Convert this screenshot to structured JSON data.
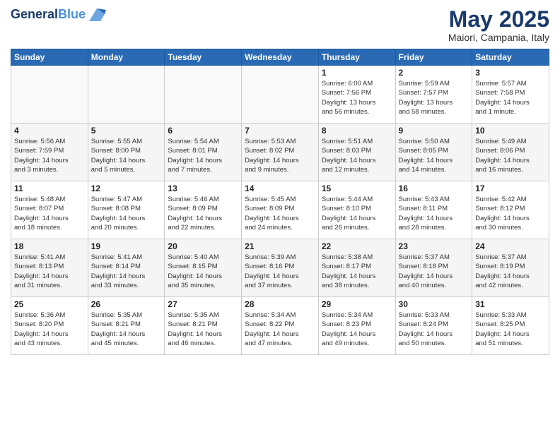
{
  "header": {
    "logo_line1": "General",
    "logo_line2": "Blue",
    "month": "May 2025",
    "location": "Maiori, Campania, Italy"
  },
  "weekdays": [
    "Sunday",
    "Monday",
    "Tuesday",
    "Wednesday",
    "Thursday",
    "Friday",
    "Saturday"
  ],
  "weeks": [
    [
      {
        "day": "",
        "info": ""
      },
      {
        "day": "",
        "info": ""
      },
      {
        "day": "",
        "info": ""
      },
      {
        "day": "",
        "info": ""
      },
      {
        "day": "1",
        "info": "Sunrise: 6:00 AM\nSunset: 7:56 PM\nDaylight: 13 hours\nand 56 minutes."
      },
      {
        "day": "2",
        "info": "Sunrise: 5:59 AM\nSunset: 7:57 PM\nDaylight: 13 hours\nand 58 minutes."
      },
      {
        "day": "3",
        "info": "Sunrise: 5:57 AM\nSunset: 7:58 PM\nDaylight: 14 hours\nand 1 minute."
      }
    ],
    [
      {
        "day": "4",
        "info": "Sunrise: 5:56 AM\nSunset: 7:59 PM\nDaylight: 14 hours\nand 3 minutes."
      },
      {
        "day": "5",
        "info": "Sunrise: 5:55 AM\nSunset: 8:00 PM\nDaylight: 14 hours\nand 5 minutes."
      },
      {
        "day": "6",
        "info": "Sunrise: 5:54 AM\nSunset: 8:01 PM\nDaylight: 14 hours\nand 7 minutes."
      },
      {
        "day": "7",
        "info": "Sunrise: 5:53 AM\nSunset: 8:02 PM\nDaylight: 14 hours\nand 9 minutes."
      },
      {
        "day": "8",
        "info": "Sunrise: 5:51 AM\nSunset: 8:03 PM\nDaylight: 14 hours\nand 12 minutes."
      },
      {
        "day": "9",
        "info": "Sunrise: 5:50 AM\nSunset: 8:05 PM\nDaylight: 14 hours\nand 14 minutes."
      },
      {
        "day": "10",
        "info": "Sunrise: 5:49 AM\nSunset: 8:06 PM\nDaylight: 14 hours\nand 16 minutes."
      }
    ],
    [
      {
        "day": "11",
        "info": "Sunrise: 5:48 AM\nSunset: 8:07 PM\nDaylight: 14 hours\nand 18 minutes."
      },
      {
        "day": "12",
        "info": "Sunrise: 5:47 AM\nSunset: 8:08 PM\nDaylight: 14 hours\nand 20 minutes."
      },
      {
        "day": "13",
        "info": "Sunrise: 5:46 AM\nSunset: 8:09 PM\nDaylight: 14 hours\nand 22 minutes."
      },
      {
        "day": "14",
        "info": "Sunrise: 5:45 AM\nSunset: 8:09 PM\nDaylight: 14 hours\nand 24 minutes."
      },
      {
        "day": "15",
        "info": "Sunrise: 5:44 AM\nSunset: 8:10 PM\nDaylight: 14 hours\nand 26 minutes."
      },
      {
        "day": "16",
        "info": "Sunrise: 5:43 AM\nSunset: 8:11 PM\nDaylight: 14 hours\nand 28 minutes."
      },
      {
        "day": "17",
        "info": "Sunrise: 5:42 AM\nSunset: 8:12 PM\nDaylight: 14 hours\nand 30 minutes."
      }
    ],
    [
      {
        "day": "18",
        "info": "Sunrise: 5:41 AM\nSunset: 8:13 PM\nDaylight: 14 hours\nand 31 minutes."
      },
      {
        "day": "19",
        "info": "Sunrise: 5:41 AM\nSunset: 8:14 PM\nDaylight: 14 hours\nand 33 minutes."
      },
      {
        "day": "20",
        "info": "Sunrise: 5:40 AM\nSunset: 8:15 PM\nDaylight: 14 hours\nand 35 minutes."
      },
      {
        "day": "21",
        "info": "Sunrise: 5:39 AM\nSunset: 8:16 PM\nDaylight: 14 hours\nand 37 minutes."
      },
      {
        "day": "22",
        "info": "Sunrise: 5:38 AM\nSunset: 8:17 PM\nDaylight: 14 hours\nand 38 minutes."
      },
      {
        "day": "23",
        "info": "Sunrise: 5:37 AM\nSunset: 8:18 PM\nDaylight: 14 hours\nand 40 minutes."
      },
      {
        "day": "24",
        "info": "Sunrise: 5:37 AM\nSunset: 8:19 PM\nDaylight: 14 hours\nand 42 minutes."
      }
    ],
    [
      {
        "day": "25",
        "info": "Sunrise: 5:36 AM\nSunset: 8:20 PM\nDaylight: 14 hours\nand 43 minutes."
      },
      {
        "day": "26",
        "info": "Sunrise: 5:35 AM\nSunset: 8:21 PM\nDaylight: 14 hours\nand 45 minutes."
      },
      {
        "day": "27",
        "info": "Sunrise: 5:35 AM\nSunset: 8:21 PM\nDaylight: 14 hours\nand 46 minutes."
      },
      {
        "day": "28",
        "info": "Sunrise: 5:34 AM\nSunset: 8:22 PM\nDaylight: 14 hours\nand 47 minutes."
      },
      {
        "day": "29",
        "info": "Sunrise: 5:34 AM\nSunset: 8:23 PM\nDaylight: 14 hours\nand 49 minutes."
      },
      {
        "day": "30",
        "info": "Sunrise: 5:33 AM\nSunset: 8:24 PM\nDaylight: 14 hours\nand 50 minutes."
      },
      {
        "day": "31",
        "info": "Sunrise: 5:33 AM\nSunset: 8:25 PM\nDaylight: 14 hours\nand 51 minutes."
      }
    ]
  ]
}
